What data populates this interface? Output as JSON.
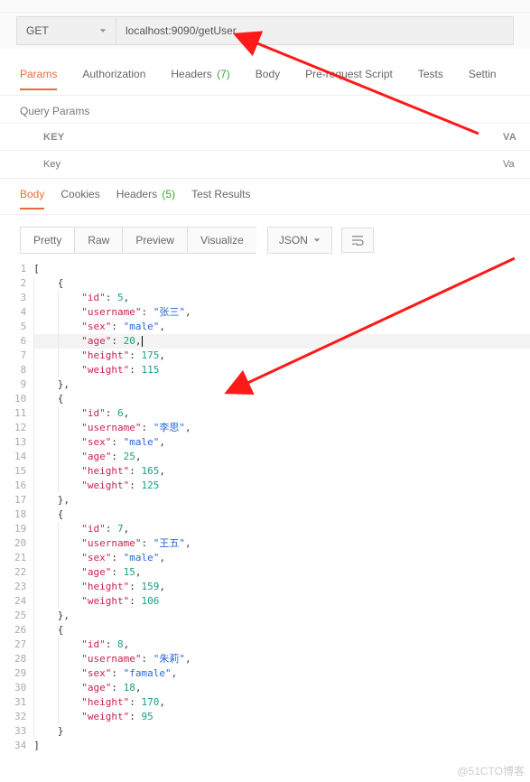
{
  "request": {
    "method": "GET",
    "url": "localhost:9090/getUser",
    "tabs": {
      "params": "Params",
      "authorization": "Authorization",
      "headers": "Headers",
      "headers_count": "(7)",
      "body": "Body",
      "prerequest": "Pre-request Script",
      "tests": "Tests",
      "settings": "Settin"
    },
    "query_params_label": "Query Params",
    "table": {
      "key_header": "KEY",
      "value_header": "VA",
      "key_placeholder": "Key",
      "value_placeholder": "Va"
    }
  },
  "response": {
    "tabs": {
      "body": "Body",
      "cookies": "Cookies",
      "headers": "Headers",
      "headers_count": "(5)",
      "test_results": "Test Results"
    },
    "view_buttons": {
      "pretty": "Pretty",
      "raw": "Raw",
      "preview": "Preview",
      "visualize": "Visualize"
    },
    "format": "JSON"
  },
  "code_lines": [
    {
      "n": 1,
      "indent": 0,
      "tokens": [
        {
          "t": "p",
          "v": "["
        }
      ]
    },
    {
      "n": 2,
      "indent": 1,
      "tokens": [
        {
          "t": "p",
          "v": "{"
        }
      ]
    },
    {
      "n": 3,
      "indent": 2,
      "tokens": [
        {
          "t": "k",
          "v": "\"id\""
        },
        {
          "t": "p",
          "v": ": "
        },
        {
          "t": "n",
          "v": "5"
        },
        {
          "t": "p",
          "v": ","
        }
      ]
    },
    {
      "n": 4,
      "indent": 2,
      "tokens": [
        {
          "t": "k",
          "v": "\"username\""
        },
        {
          "t": "p",
          "v": ": "
        },
        {
          "t": "s",
          "v": "\"张三\""
        },
        {
          "t": "p",
          "v": ","
        }
      ]
    },
    {
      "n": 5,
      "indent": 2,
      "tokens": [
        {
          "t": "k",
          "v": "\"sex\""
        },
        {
          "t": "p",
          "v": ": "
        },
        {
          "t": "s",
          "v": "\"male\""
        },
        {
          "t": "p",
          "v": ","
        }
      ]
    },
    {
      "n": 6,
      "indent": 2,
      "highlight": true,
      "cursor": true,
      "tokens": [
        {
          "t": "k",
          "v": "\"age\""
        },
        {
          "t": "p",
          "v": ": "
        },
        {
          "t": "n",
          "v": "20"
        },
        {
          "t": "p",
          "v": ","
        }
      ]
    },
    {
      "n": 7,
      "indent": 2,
      "tokens": [
        {
          "t": "k",
          "v": "\"height\""
        },
        {
          "t": "p",
          "v": ": "
        },
        {
          "t": "n",
          "v": "175"
        },
        {
          "t": "p",
          "v": ","
        }
      ]
    },
    {
      "n": 8,
      "indent": 2,
      "tokens": [
        {
          "t": "k",
          "v": "\"weight\""
        },
        {
          "t": "p",
          "v": ": "
        },
        {
          "t": "n",
          "v": "115"
        }
      ]
    },
    {
      "n": 9,
      "indent": 1,
      "tokens": [
        {
          "t": "p",
          "v": "},"
        }
      ]
    },
    {
      "n": 10,
      "indent": 1,
      "tokens": [
        {
          "t": "p",
          "v": "{"
        }
      ]
    },
    {
      "n": 11,
      "indent": 2,
      "tokens": [
        {
          "t": "k",
          "v": "\"id\""
        },
        {
          "t": "p",
          "v": ": "
        },
        {
          "t": "n",
          "v": "6"
        },
        {
          "t": "p",
          "v": ","
        }
      ]
    },
    {
      "n": 12,
      "indent": 2,
      "tokens": [
        {
          "t": "k",
          "v": "\"username\""
        },
        {
          "t": "p",
          "v": ": "
        },
        {
          "t": "s",
          "v": "\"李思\""
        },
        {
          "t": "p",
          "v": ","
        }
      ]
    },
    {
      "n": 13,
      "indent": 2,
      "tokens": [
        {
          "t": "k",
          "v": "\"sex\""
        },
        {
          "t": "p",
          "v": ": "
        },
        {
          "t": "s",
          "v": "\"male\""
        },
        {
          "t": "p",
          "v": ","
        }
      ]
    },
    {
      "n": 14,
      "indent": 2,
      "tokens": [
        {
          "t": "k",
          "v": "\"age\""
        },
        {
          "t": "p",
          "v": ": "
        },
        {
          "t": "n",
          "v": "25"
        },
        {
          "t": "p",
          "v": ","
        }
      ]
    },
    {
      "n": 15,
      "indent": 2,
      "tokens": [
        {
          "t": "k",
          "v": "\"height\""
        },
        {
          "t": "p",
          "v": ": "
        },
        {
          "t": "n",
          "v": "165"
        },
        {
          "t": "p",
          "v": ","
        }
      ]
    },
    {
      "n": 16,
      "indent": 2,
      "tokens": [
        {
          "t": "k",
          "v": "\"weight\""
        },
        {
          "t": "p",
          "v": ": "
        },
        {
          "t": "n",
          "v": "125"
        }
      ]
    },
    {
      "n": 17,
      "indent": 1,
      "tokens": [
        {
          "t": "p",
          "v": "},"
        }
      ]
    },
    {
      "n": 18,
      "indent": 1,
      "tokens": [
        {
          "t": "p",
          "v": "{"
        }
      ]
    },
    {
      "n": 19,
      "indent": 2,
      "tokens": [
        {
          "t": "k",
          "v": "\"id\""
        },
        {
          "t": "p",
          "v": ": "
        },
        {
          "t": "n",
          "v": "7"
        },
        {
          "t": "p",
          "v": ","
        }
      ]
    },
    {
      "n": 20,
      "indent": 2,
      "tokens": [
        {
          "t": "k",
          "v": "\"username\""
        },
        {
          "t": "p",
          "v": ": "
        },
        {
          "t": "s",
          "v": "\"王五\""
        },
        {
          "t": "p",
          "v": ","
        }
      ]
    },
    {
      "n": 21,
      "indent": 2,
      "tokens": [
        {
          "t": "k",
          "v": "\"sex\""
        },
        {
          "t": "p",
          "v": ": "
        },
        {
          "t": "s",
          "v": "\"male\""
        },
        {
          "t": "p",
          "v": ","
        }
      ]
    },
    {
      "n": 22,
      "indent": 2,
      "tokens": [
        {
          "t": "k",
          "v": "\"age\""
        },
        {
          "t": "p",
          "v": ": "
        },
        {
          "t": "n",
          "v": "15"
        },
        {
          "t": "p",
          "v": ","
        }
      ]
    },
    {
      "n": 23,
      "indent": 2,
      "tokens": [
        {
          "t": "k",
          "v": "\"height\""
        },
        {
          "t": "p",
          "v": ": "
        },
        {
          "t": "n",
          "v": "159"
        },
        {
          "t": "p",
          "v": ","
        }
      ]
    },
    {
      "n": 24,
      "indent": 2,
      "tokens": [
        {
          "t": "k",
          "v": "\"weight\""
        },
        {
          "t": "p",
          "v": ": "
        },
        {
          "t": "n",
          "v": "106"
        }
      ]
    },
    {
      "n": 25,
      "indent": 1,
      "tokens": [
        {
          "t": "p",
          "v": "},"
        }
      ]
    },
    {
      "n": 26,
      "indent": 1,
      "tokens": [
        {
          "t": "p",
          "v": "{"
        }
      ]
    },
    {
      "n": 27,
      "indent": 2,
      "tokens": [
        {
          "t": "k",
          "v": "\"id\""
        },
        {
          "t": "p",
          "v": ": "
        },
        {
          "t": "n",
          "v": "8"
        },
        {
          "t": "p",
          "v": ","
        }
      ]
    },
    {
      "n": 28,
      "indent": 2,
      "tokens": [
        {
          "t": "k",
          "v": "\"username\""
        },
        {
          "t": "p",
          "v": ": "
        },
        {
          "t": "s",
          "v": "\"朱莉\""
        },
        {
          "t": "p",
          "v": ","
        }
      ]
    },
    {
      "n": 29,
      "indent": 2,
      "tokens": [
        {
          "t": "k",
          "v": "\"sex\""
        },
        {
          "t": "p",
          "v": ": "
        },
        {
          "t": "s",
          "v": "\"famale\""
        },
        {
          "t": "p",
          "v": ","
        }
      ]
    },
    {
      "n": 30,
      "indent": 2,
      "tokens": [
        {
          "t": "k",
          "v": "\"age\""
        },
        {
          "t": "p",
          "v": ": "
        },
        {
          "t": "n",
          "v": "18"
        },
        {
          "t": "p",
          "v": ","
        }
      ]
    },
    {
      "n": 31,
      "indent": 2,
      "tokens": [
        {
          "t": "k",
          "v": "\"height\""
        },
        {
          "t": "p",
          "v": ": "
        },
        {
          "t": "n",
          "v": "170"
        },
        {
          "t": "p",
          "v": ","
        }
      ]
    },
    {
      "n": 32,
      "indent": 2,
      "tokens": [
        {
          "t": "k",
          "v": "\"weight\""
        },
        {
          "t": "p",
          "v": ": "
        },
        {
          "t": "n",
          "v": "95"
        }
      ]
    },
    {
      "n": 33,
      "indent": 1,
      "tokens": [
        {
          "t": "p",
          "v": "}"
        }
      ]
    },
    {
      "n": 34,
      "indent": 0,
      "tokens": [
        {
          "t": "p",
          "v": "]"
        }
      ]
    }
  ],
  "watermark": "@51CTO博客"
}
